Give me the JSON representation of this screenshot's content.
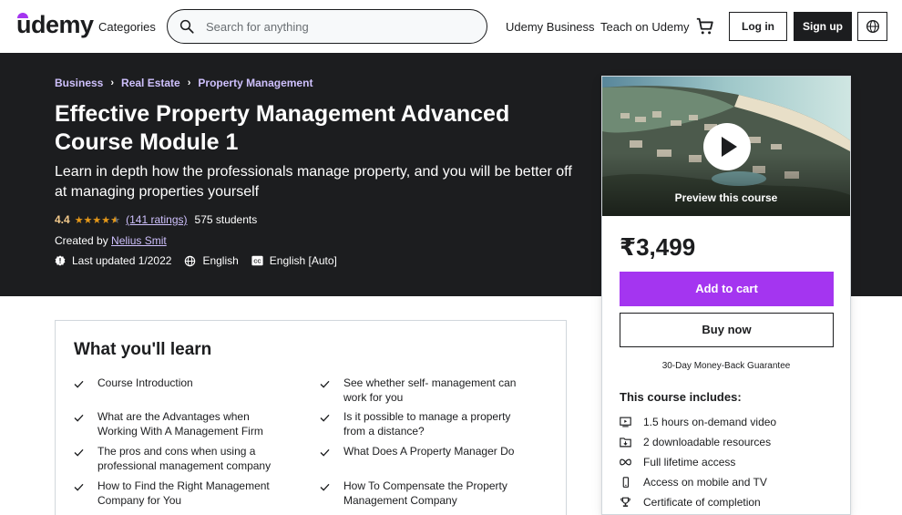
{
  "header": {
    "logo": "udemy",
    "categories": "Categories",
    "search_placeholder": "Search for anything",
    "udemy_business": "Udemy Business",
    "teach": "Teach on Udemy",
    "login": "Log in",
    "signup": "Sign up"
  },
  "breadcrumb": [
    "Business",
    "Real Estate",
    "Property Management"
  ],
  "course": {
    "title": "Effective Property Management Advanced Course Module 1",
    "subtitle": "Learn in depth how the professionals manage property, and you will be better off at managing properties yourself",
    "rating": "4.4",
    "stars_value": 4.4,
    "ratings_count": "(141 ratings)",
    "students": "575 students",
    "created_by_label": "Created by",
    "instructor": "Nelius Smit",
    "last_updated": "Last updated 1/2022",
    "language": "English",
    "captions": "English [Auto]"
  },
  "sidebar": {
    "preview_label": "Preview this course",
    "price": "₹3,499",
    "add_to_cart": "Add to cart",
    "buy_now": "Buy now",
    "guarantee": "30-Day Money-Back Guarantee",
    "includes_title": "This course includes:",
    "includes": [
      {
        "icon": "video-icon",
        "label": "1.5 hours on-demand video"
      },
      {
        "icon": "file-icon",
        "label": "2 downloadable resources"
      },
      {
        "icon": "infinity-icon",
        "label": "Full lifetime access"
      },
      {
        "icon": "mobile-icon",
        "label": "Access on mobile and TV"
      },
      {
        "icon": "trophy-icon",
        "label": "Certificate of completion"
      }
    ]
  },
  "learn": {
    "title": "What you'll learn",
    "items": [
      "Course Introduction",
      "See whether self- management can work for you",
      "What are the Advantages when Working With A Management Firm",
      "Is it possible to manage a property from a distance?",
      "The pros and cons when using a professional management company",
      "What Does A Property Manager Do",
      "How to Find the Right Management Company for You",
      "How To Compensate the Property Management Company"
    ]
  },
  "colors": {
    "accent": "#a435f0",
    "dark": "#1c1d1f",
    "link_light": "#cec0fc",
    "star": "#e59819"
  }
}
